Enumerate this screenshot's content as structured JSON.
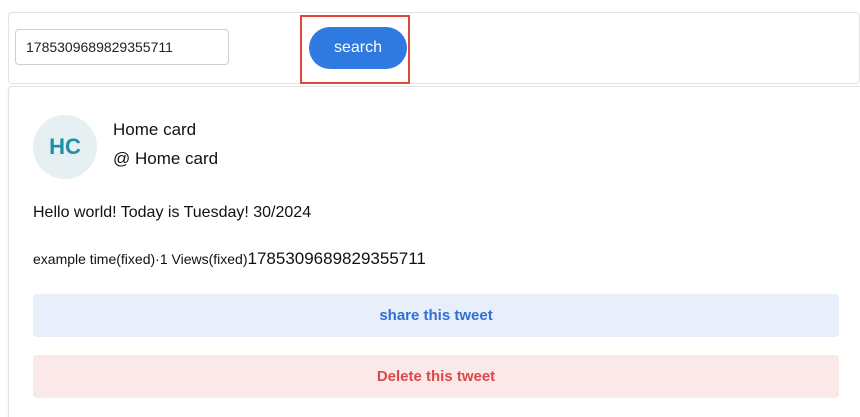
{
  "search": {
    "input_value": "1785309689829355711",
    "button_label": "search"
  },
  "tweet": {
    "avatar_initials": "HC",
    "display_name": "Home card",
    "handle": "@ Home card",
    "text": "Hello world! Today is Tuesday! 30/2024",
    "meta": {
      "time_label": "example time(fixed)",
      "separator": "·",
      "views": "1 Views(fixed)",
      "tweet_id": "1785309689829355711"
    },
    "share_label": "share this tweet",
    "delete_label": "Delete this tweet"
  },
  "colors": {
    "primary": "#2f7ae0",
    "share_bg": "#e9effa",
    "delete_bg": "#fbe9e9",
    "delete_text": "#e0474a",
    "highlight": "#e0473a",
    "avatar_bg": "#e6f0f2",
    "avatar_text": "#1d8fa6"
  }
}
